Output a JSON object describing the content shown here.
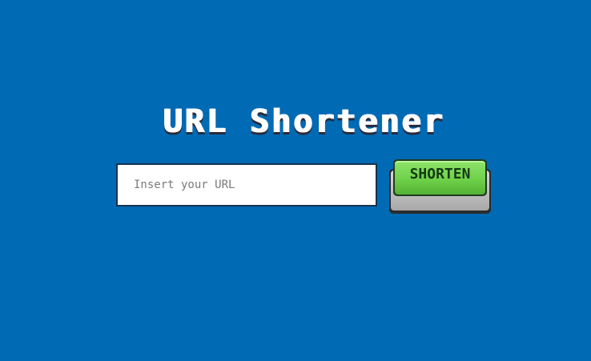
{
  "header": {
    "title": "URL Shortener"
  },
  "form": {
    "url_placeholder": "Insert your URL",
    "url_value": "",
    "shorten_label": "SHORTEN"
  },
  "colors": {
    "background": "#006ab4",
    "button_green": "#6fd14a",
    "input_border": "#16324d"
  }
}
